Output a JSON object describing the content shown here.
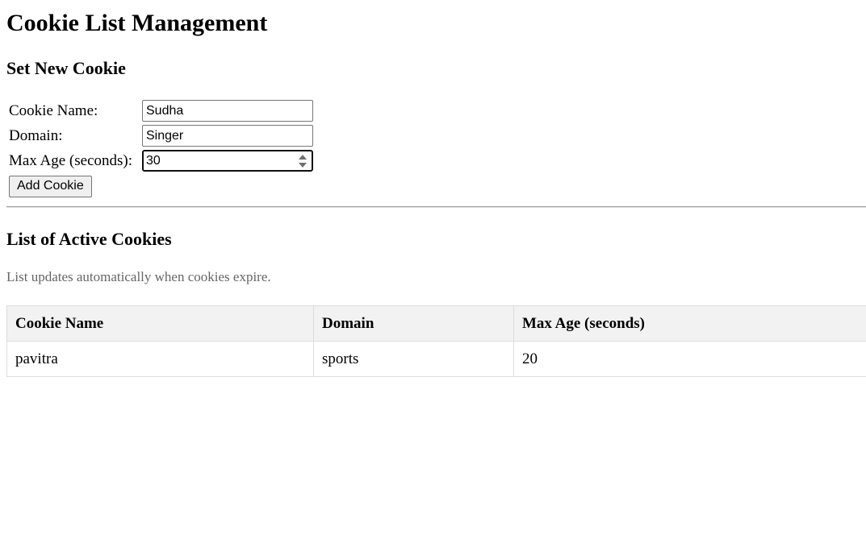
{
  "page": {
    "title": "Cookie List Management"
  },
  "form": {
    "section_title": "Set New Cookie",
    "name_label": "Cookie Name:",
    "name_value": "Sudha",
    "domain_label": "Domain:",
    "domain_value": "Singer",
    "maxage_label": "Max Age (seconds):",
    "maxage_value": "30",
    "submit_label": "Add Cookie"
  },
  "list": {
    "section_title": "List of Active Cookies",
    "note": "List updates automatically when cookies expire.",
    "columns": [
      "Cookie Name",
      "Domain",
      "Max Age (seconds)"
    ],
    "rows": [
      {
        "name": "pavitra",
        "domain": "sports",
        "max_age": "20"
      }
    ]
  },
  "colors": {
    "header_background": "#f2f2f2",
    "border": "#dddddd",
    "note_text": "#666666"
  },
  "icons": {
    "spinner": "spin-arrows-icon"
  }
}
